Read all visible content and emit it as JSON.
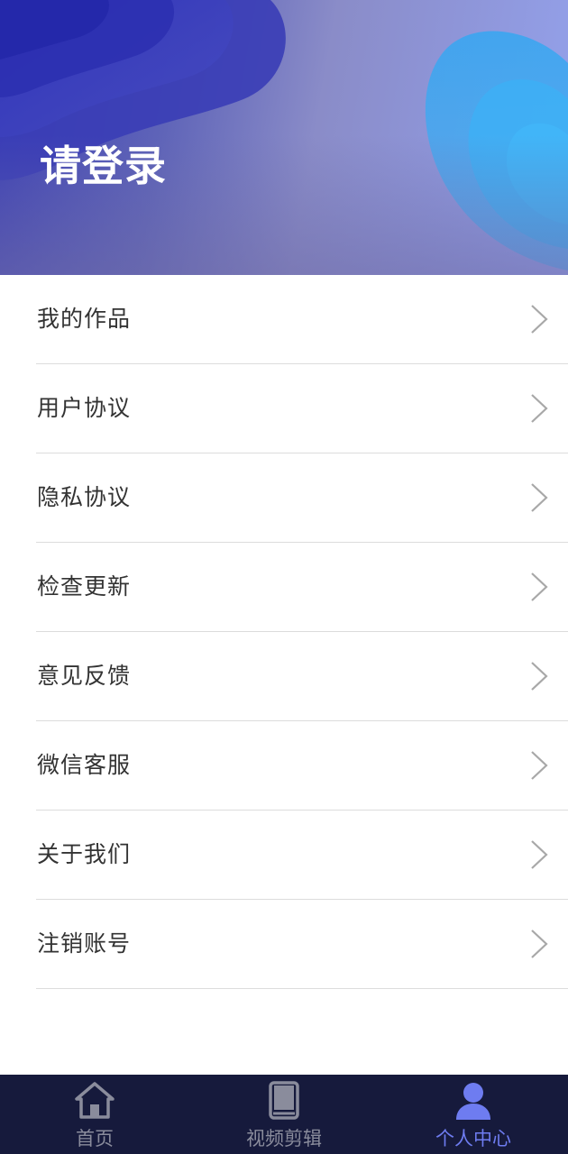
{
  "header": {
    "login_text": "请登录"
  },
  "menu": {
    "items": [
      {
        "label": "我的作品",
        "icon": "chevron-right-icon"
      },
      {
        "label": "用户协议",
        "icon": "chevron-right-icon"
      },
      {
        "label": "隐私协议",
        "icon": "chevron-right-icon"
      },
      {
        "label": "检查更新",
        "icon": "chevron-right-icon"
      },
      {
        "label": "意见反馈",
        "icon": "chevron-right-icon"
      },
      {
        "label": "微信客服",
        "icon": "chevron-right-icon"
      },
      {
        "label": "关于我们",
        "icon": "chevron-right-icon"
      },
      {
        "label": "注销账号",
        "icon": "chevron-right-icon"
      }
    ]
  },
  "bottom_nav": {
    "items": [
      {
        "label": "首页",
        "icon": "home-icon",
        "active": false
      },
      {
        "label": "视频剪辑",
        "icon": "book-icon",
        "active": false
      },
      {
        "label": "个人中心",
        "icon": "user-icon",
        "active": true
      }
    ]
  },
  "colors": {
    "nav_background": "#161a3c",
    "nav_active": "#6e7cf0",
    "nav_inactive": "#8a8c9c",
    "header_gradient_start": "#3c3fb4",
    "header_gradient_end": "#94a2ec",
    "text": "#333333",
    "divider": "#dcdcdc"
  }
}
